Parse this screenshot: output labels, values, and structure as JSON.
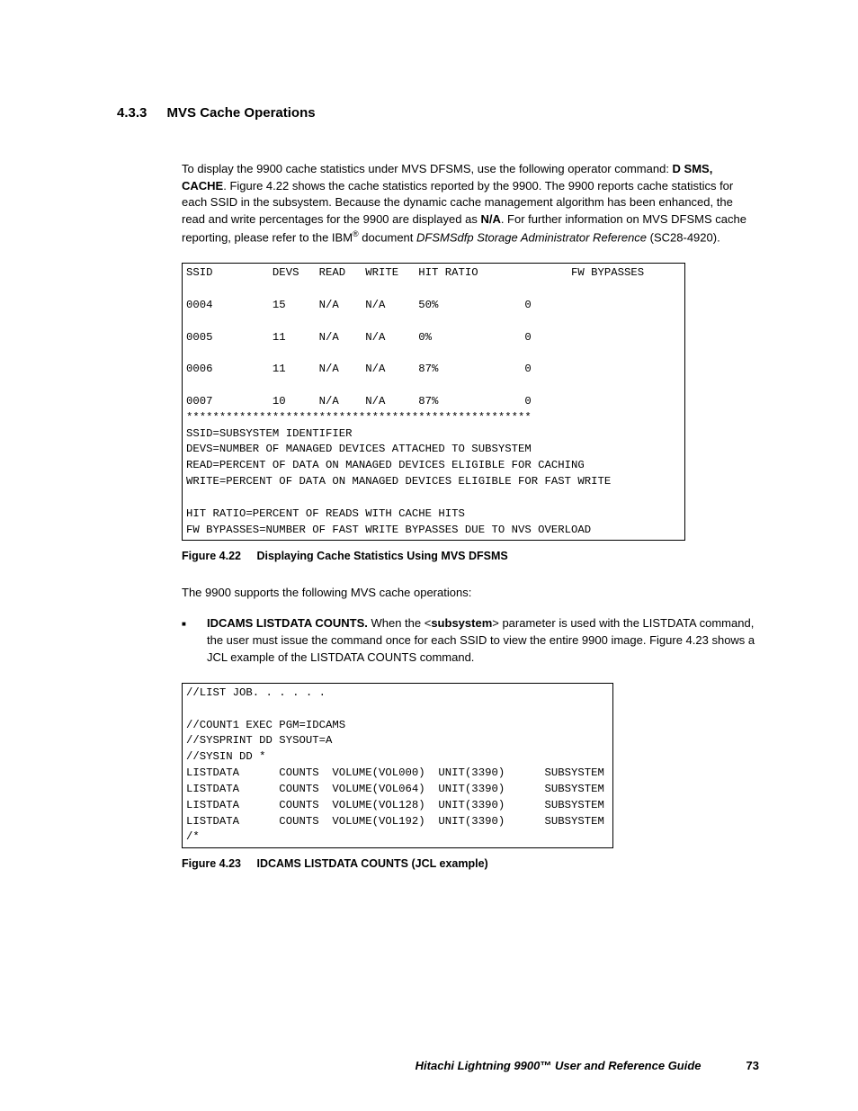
{
  "section": {
    "number": "4.3.3",
    "title": "MVS Cache Operations"
  },
  "para1_parts": {
    "a": "To display the 9900 cache statistics under MVS DFSMS, use the following operator command: ",
    "cmd": "D SMS, CACHE",
    "b": ". Figure 4.22 shows the cache statistics reported by the 9900. The 9900 reports cache statistics for each SSID in the subsystem. Because the dynamic cache management algorithm has been enhanced, the read and write percentages for the 9900 are displayed as ",
    "na": "N/A",
    "c": ". For further information on MVS DFSMS cache reporting, please refer to the IBM",
    "reg": "®",
    "d": " document ",
    "doc": "DFSMSdfp Storage Administrator Reference",
    "e": " (SC28-4920)."
  },
  "code1": "SSID         DEVS   READ   WRITE   HIT RATIO              FW BYPASSES\n\n0004         15     N/A    N/A     50%             0\n\n0005         11     N/A    N/A     0%              0\n\n0006         11     N/A    N/A     87%             0\n\n0007         10     N/A    N/A     87%             0\n****************************************************\nSSID=SUBSYSTEM IDENTIFIER\nDEVS=NUMBER OF MANAGED DEVICES ATTACHED TO SUBSYSTEM\nREAD=PERCENT OF DATA ON MANAGED DEVICES ELIGIBLE FOR CACHING\nWRITE=PERCENT OF DATA ON MANAGED DEVICES ELIGIBLE FOR FAST WRITE\n\nHIT RATIO=PERCENT OF READS WITH CACHE HITS\nFW BYPASSES=NUMBER OF FAST WRITE BYPASSES DUE TO NVS OVERLOAD",
  "fig1": {
    "num": "Figure 4.22",
    "cap": "Displaying Cache Statistics Using MVS DFSMS"
  },
  "para2": "The 9900 supports the following MVS cache operations:",
  "bullet1_parts": {
    "lead": "IDCAMS LISTDATA COUNTS.",
    "a": " When the <",
    "sub": "subsystem",
    "b": "> parameter is used with the LISTDATA command, the user must issue the command once for each SSID to view the entire 9900 image. Figure 4.23 shows a JCL example of the LISTDATA COUNTS command."
  },
  "code2": "//LIST JOB. . . . . .\n\n//COUNT1 EXEC PGM=IDCAMS\n//SYSPRINT DD SYSOUT=A\n//SYSIN DD *\nLISTDATA      COUNTS  VOLUME(VOL000)  UNIT(3390)      SUBSYSTEM\nLISTDATA      COUNTS  VOLUME(VOL064)  UNIT(3390)      SUBSYSTEM\nLISTDATA      COUNTS  VOLUME(VOL128)  UNIT(3390)      SUBSYSTEM\nLISTDATA      COUNTS  VOLUME(VOL192)  UNIT(3390)      SUBSYSTEM\n/*",
  "fig2": {
    "num": "Figure 4.23",
    "cap": "IDCAMS LISTDATA COUNTS (JCL example)"
  },
  "footer": {
    "title_a": "Hitachi Lightning 9900",
    "tm": "™",
    "title_b": " User and Reference Guide",
    "page": "73"
  }
}
